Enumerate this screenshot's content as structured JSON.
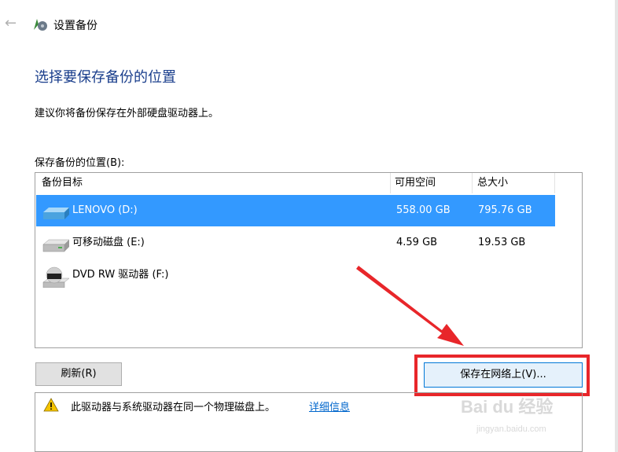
{
  "window": {
    "title": "设置备份"
  },
  "page": {
    "heading": "选择要保存备份的位置",
    "description": "建议你将备份保存在外部硬盘驱动器上。",
    "location_label": "保存备份的位置(B):"
  },
  "table": {
    "headers": {
      "target": "备份目标",
      "free": "可用空间",
      "total": "总大小"
    },
    "rows": [
      {
        "name": "LENOVO (D:)",
        "free": "558.00 GB",
        "total": "795.76 GB",
        "icon": "hard-drive-icon",
        "selected": true
      },
      {
        "name": "可移动磁盘 (E:)",
        "free": "4.59 GB",
        "total": "19.53 GB",
        "icon": "removable-drive-icon",
        "selected": false
      },
      {
        "name": "DVD RW 驱动器 (F:)",
        "free": "",
        "total": "",
        "icon": "dvd-drive-icon",
        "selected": false
      }
    ]
  },
  "buttons": {
    "refresh": "刷新(R)",
    "save_network": "保存在网络上(V)..."
  },
  "warning": {
    "text": "此驱动器与系统驱动器在同一个物理磁盘上。",
    "link": "详细信息"
  },
  "watermark": {
    "main": "Bai du 经验",
    "sub": "jingyan.baidu.com"
  },
  "colors": {
    "selection": "#3399ff",
    "heading": "#1a3e8c",
    "highlight": "#e8262a",
    "link": "#0066cc"
  }
}
